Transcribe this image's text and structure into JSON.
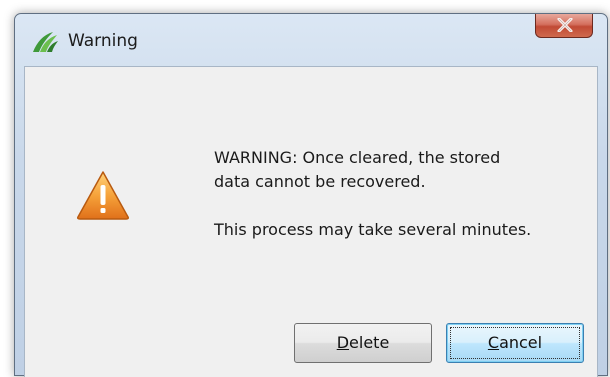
{
  "window": {
    "title": "Warning",
    "icons": {
      "app": "leaf-logo-icon",
      "close": "close-icon",
      "warning": "warning-triangle-icon"
    },
    "colors": {
      "titlebar": "#c9d8ea",
      "close_button": "#c14a35",
      "client_background": "#f0f0f0",
      "warning_orange": "#f08a1c",
      "logo_green": "#3f9a3a"
    }
  },
  "message": {
    "line1": "WARNING: Once cleared, the stored\ndata cannot be recovered.",
    "line2": "This process may take several minutes."
  },
  "buttons": {
    "delete": {
      "accel": "D",
      "rest": "elete"
    },
    "cancel": {
      "accel": "C",
      "rest": "ancel"
    }
  }
}
